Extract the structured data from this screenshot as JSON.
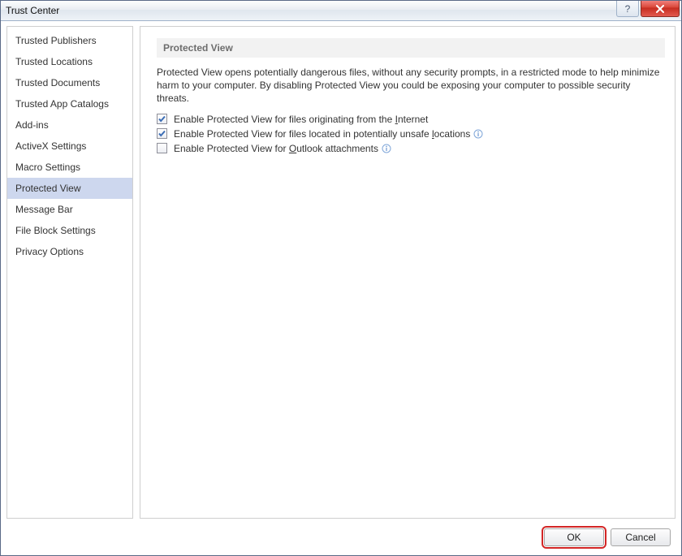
{
  "window": {
    "title": "Trust Center"
  },
  "sidebar": {
    "items": [
      {
        "label": "Trusted Publishers",
        "selected": false
      },
      {
        "label": "Trusted Locations",
        "selected": false
      },
      {
        "label": "Trusted Documents",
        "selected": false
      },
      {
        "label": "Trusted App Catalogs",
        "selected": false
      },
      {
        "label": "Add-ins",
        "selected": false
      },
      {
        "label": "ActiveX Settings",
        "selected": false
      },
      {
        "label": "Macro Settings",
        "selected": false
      },
      {
        "label": "Protected View",
        "selected": true
      },
      {
        "label": "Message Bar",
        "selected": false
      },
      {
        "label": "File Block Settings",
        "selected": false
      },
      {
        "label": "Privacy Options",
        "selected": false
      }
    ]
  },
  "main": {
    "section_title": "Protected View",
    "description": "Protected View opens potentially dangerous files, without any security prompts, in a restricted mode to help minimize harm to your computer. By disabling Protected View you could be exposing your computer to possible security threats.",
    "options": [
      {
        "label_html": "Enable Protected View for files originating from the <u>I</u>nternet",
        "checked": true,
        "info": false
      },
      {
        "label_html": "Enable Protected View for files located in potentially unsafe <u>l</u>ocations",
        "checked": true,
        "info": true
      },
      {
        "label_html": "Enable Protected View for <u>O</u>utlook attachments",
        "checked": false,
        "info": true
      }
    ]
  },
  "footer": {
    "ok": "OK",
    "cancel": "Cancel"
  }
}
